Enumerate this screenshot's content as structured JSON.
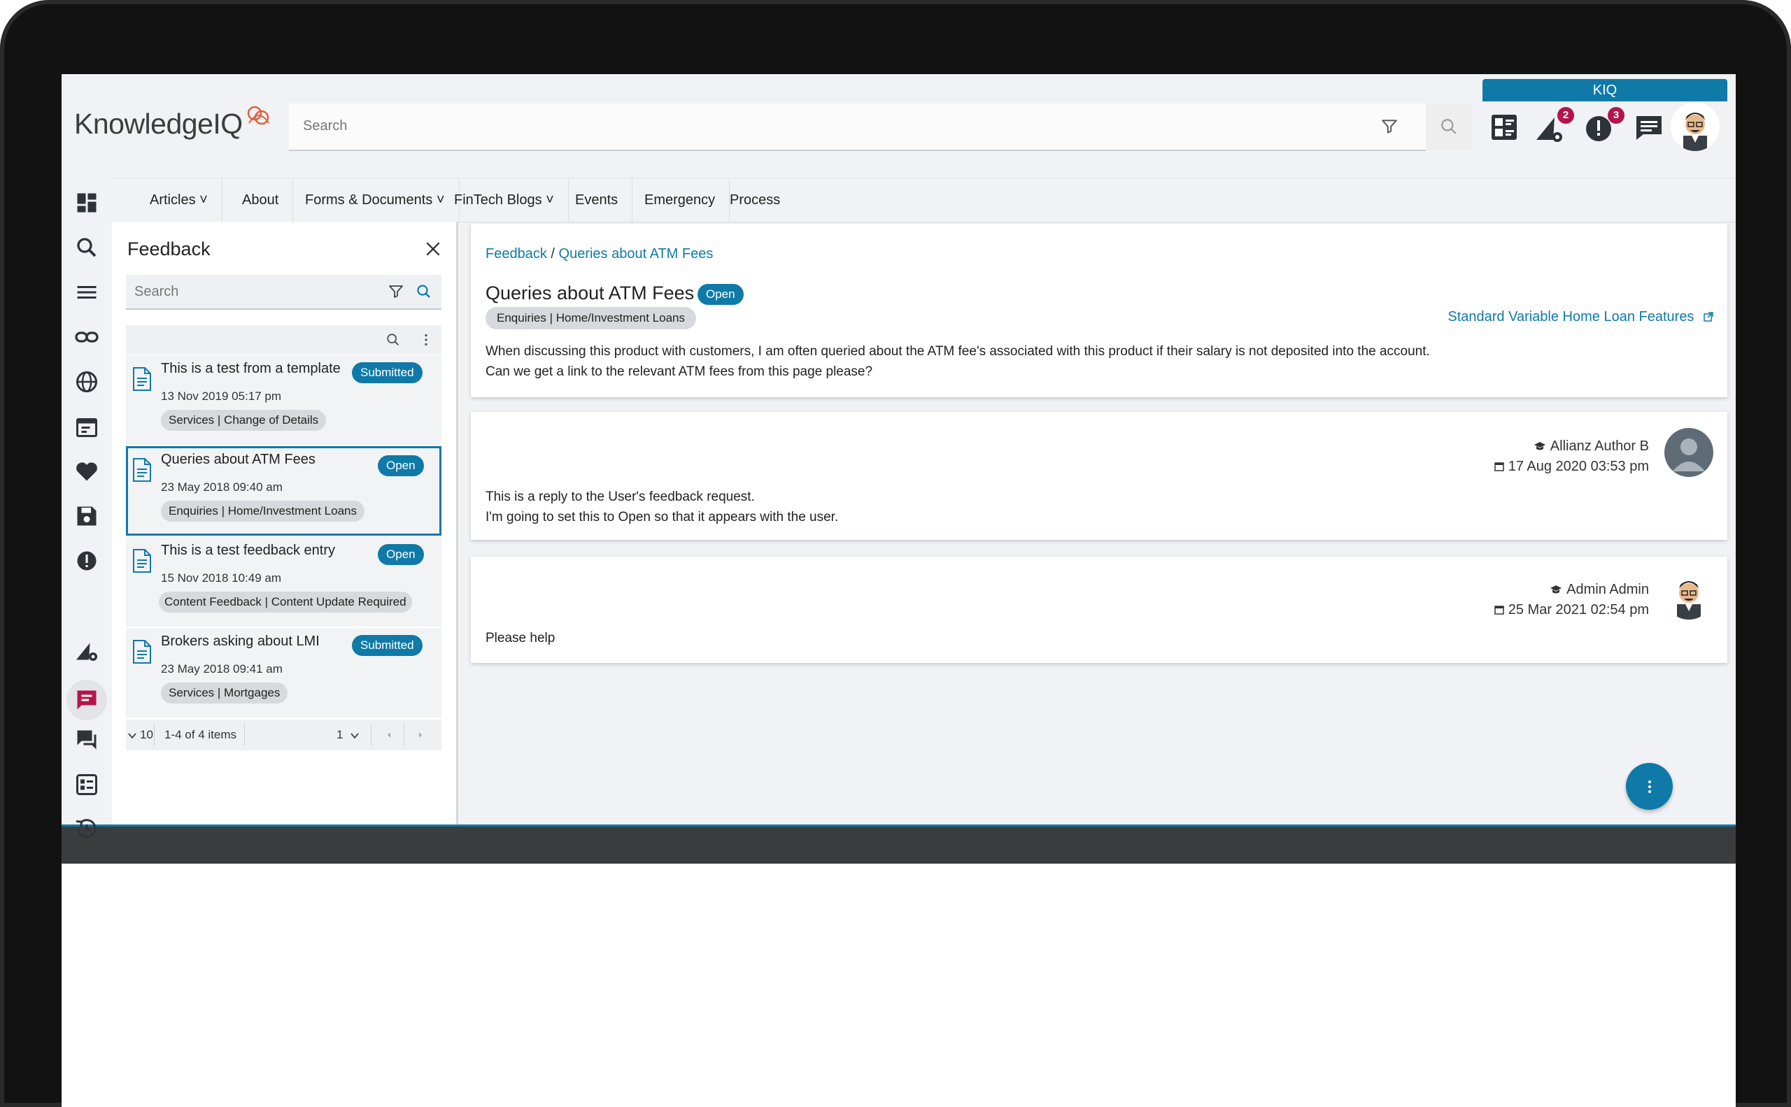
{
  "app": {
    "logo_text": "KnowledgeIQ",
    "kiq_tab": "KIQ"
  },
  "search": {
    "placeholder": "Search"
  },
  "header_badges": {
    "alerts_count": "2",
    "warnings_count": "3"
  },
  "nav": {
    "items": [
      {
        "label": "Articles ˅"
      },
      {
        "label": "About"
      },
      {
        "label": "Forms & Documents ˅"
      },
      {
        "label": "FinTech Blogs ˅"
      },
      {
        "label": "Events"
      },
      {
        "label": "Emergency"
      },
      {
        "label": "Process"
      }
    ]
  },
  "feedback_panel": {
    "title": "Feedback",
    "search_placeholder": "Search",
    "items": [
      {
        "title": "This is a test from a template",
        "status": "Submitted",
        "date": "13 Nov 2019 05:17 pm",
        "tag": "Services | Change of Details"
      },
      {
        "title": "Queries about ATM Fees",
        "status": "Open",
        "date": "23 May 2018 09:40 am",
        "tag": "Enquiries | Home/Investment Loans"
      },
      {
        "title": "This is a test feedback entry",
        "status": "Open",
        "date": "15 Nov 2018 10:49 am",
        "tag": "Content Feedback | Content Update Required"
      },
      {
        "title": "Brokers asking about LMI",
        "status": "Submitted",
        "date": "23 May 2018 09:41 am",
        "tag": "Services | Mortgages"
      }
    ],
    "pager": {
      "page_size": "10",
      "summary": "1-4 of 4 items",
      "page": "1"
    }
  },
  "detail": {
    "breadcrumb_root": "Feedback",
    "breadcrumb_sep": " / ",
    "breadcrumb_current": "Queries about ATM Fees",
    "title": "Queries about ATM Fees",
    "status": "Open",
    "tag": "Enquiries | Home/Investment Loans",
    "linked_article": "Standard Variable Home Loan Features",
    "body_line1": "When discussing this product with customers, I am often queried about the ATM fee's associated with this product if their salary is not deposited into the account.",
    "body_line2": "Can we get a link to the relevant ATM fees from this page please?"
  },
  "replies": [
    {
      "author": "Allianz Author B",
      "date": "17 Aug 2020 03:53 pm",
      "line1": "This is a reply to the User's feedback request.",
      "line2": "I'm going to set this to Open so that it appears with the user."
    },
    {
      "author": "Admin Admin",
      "date": "25 Mar 2021 02:54 pm",
      "line1": "Please help"
    }
  ],
  "colors": {
    "accent": "#0f7aa8",
    "badge": "#b4154b",
    "active_rail_icon": "#b4154b"
  }
}
